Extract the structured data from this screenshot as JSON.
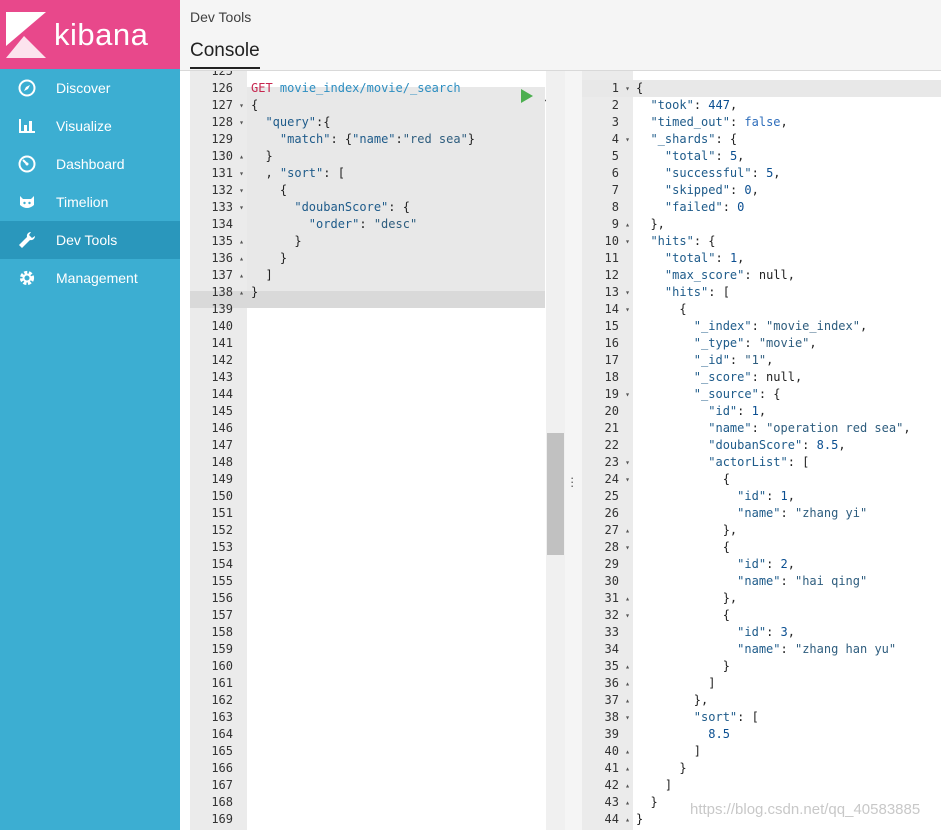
{
  "sidebar": {
    "logo_text": "kibana",
    "items": [
      {
        "label": "Discover",
        "icon": "compass-icon"
      },
      {
        "label": "Visualize",
        "icon": "bar-chart-icon"
      },
      {
        "label": "Dashboard",
        "icon": "dashboard-icon"
      },
      {
        "label": "Timelion",
        "icon": "timelion-icon"
      },
      {
        "label": "Dev Tools",
        "icon": "wrench-icon",
        "active": true
      },
      {
        "label": "Management",
        "icon": "gear-icon"
      }
    ]
  },
  "header": {
    "breadcrumb": "Dev Tools",
    "tab": "Console"
  },
  "editor": {
    "top_partial_line": "125",
    "lines": [
      {
        "n": "126",
        "fold": ""
      },
      {
        "n": "127",
        "fold": "▾"
      },
      {
        "n": "128",
        "fold": "▾"
      },
      {
        "n": "129",
        "fold": ""
      },
      {
        "n": "130",
        "fold": "▴"
      },
      {
        "n": "131",
        "fold": "▾"
      },
      {
        "n": "132",
        "fold": "▾"
      },
      {
        "n": "133",
        "fold": "▾"
      },
      {
        "n": "134",
        "fold": ""
      },
      {
        "n": "135",
        "fold": "▴"
      },
      {
        "n": "136",
        "fold": "▴"
      },
      {
        "n": "137",
        "fold": "▴"
      },
      {
        "n": "138",
        "fold": "▴"
      },
      {
        "n": "139",
        "fold": ""
      },
      {
        "n": "140",
        "fold": ""
      },
      {
        "n": "141",
        "fold": ""
      },
      {
        "n": "142",
        "fold": ""
      },
      {
        "n": "143",
        "fold": ""
      },
      {
        "n": "144",
        "fold": ""
      },
      {
        "n": "145",
        "fold": ""
      },
      {
        "n": "146",
        "fold": ""
      },
      {
        "n": "147",
        "fold": ""
      },
      {
        "n": "148",
        "fold": ""
      },
      {
        "n": "149",
        "fold": ""
      },
      {
        "n": "150",
        "fold": ""
      },
      {
        "n": "151",
        "fold": ""
      },
      {
        "n": "152",
        "fold": ""
      },
      {
        "n": "153",
        "fold": ""
      },
      {
        "n": "154",
        "fold": ""
      },
      {
        "n": "155",
        "fold": ""
      },
      {
        "n": "156",
        "fold": ""
      },
      {
        "n": "157",
        "fold": ""
      },
      {
        "n": "158",
        "fold": ""
      },
      {
        "n": "159",
        "fold": ""
      },
      {
        "n": "160",
        "fold": ""
      },
      {
        "n": "161",
        "fold": ""
      },
      {
        "n": "162",
        "fold": ""
      },
      {
        "n": "163",
        "fold": ""
      },
      {
        "n": "164",
        "fold": ""
      },
      {
        "n": "165",
        "fold": ""
      },
      {
        "n": "166",
        "fold": ""
      },
      {
        "n": "167",
        "fold": ""
      },
      {
        "n": "168",
        "fold": ""
      },
      {
        "n": "169",
        "fold": ""
      }
    ],
    "request": {
      "method": "GET",
      "url": "movie_index/movie/_search",
      "code": [
        "{",
        "  \"query\":{",
        "    \"match\": {\"name\":\"red sea\"}",
        "  }",
        "  , \"sort\": [",
        "    {",
        "      \"doubanScore\": {",
        "        \"order\": \"desc\"",
        "      }",
        "    }",
        "  ]",
        "}"
      ]
    }
  },
  "output": {
    "lines": [
      {
        "n": "1",
        "fold": "▾",
        "text": "{"
      },
      {
        "n": "2",
        "fold": "",
        "text": "  \"took\": 447,"
      },
      {
        "n": "3",
        "fold": "",
        "text": "  \"timed_out\": false,"
      },
      {
        "n": "4",
        "fold": "▾",
        "text": "  \"_shards\": {"
      },
      {
        "n": "5",
        "fold": "",
        "text": "    \"total\": 5,"
      },
      {
        "n": "6",
        "fold": "",
        "text": "    \"successful\": 5,"
      },
      {
        "n": "7",
        "fold": "",
        "text": "    \"skipped\": 0,"
      },
      {
        "n": "8",
        "fold": "",
        "text": "    \"failed\": 0"
      },
      {
        "n": "9",
        "fold": "▴",
        "text": "  },"
      },
      {
        "n": "10",
        "fold": "▾",
        "text": "  \"hits\": {"
      },
      {
        "n": "11",
        "fold": "",
        "text": "    \"total\": 1,"
      },
      {
        "n": "12",
        "fold": "",
        "text": "    \"max_score\": null,"
      },
      {
        "n": "13",
        "fold": "▾",
        "text": "    \"hits\": ["
      },
      {
        "n": "14",
        "fold": "▾",
        "text": "      {"
      },
      {
        "n": "15",
        "fold": "",
        "text": "        \"_index\": \"movie_index\","
      },
      {
        "n": "16",
        "fold": "",
        "text": "        \"_type\": \"movie\","
      },
      {
        "n": "17",
        "fold": "",
        "text": "        \"_id\": \"1\","
      },
      {
        "n": "18",
        "fold": "",
        "text": "        \"_score\": null,"
      },
      {
        "n": "19",
        "fold": "▾",
        "text": "        \"_source\": {"
      },
      {
        "n": "20",
        "fold": "",
        "text": "          \"id\": 1,"
      },
      {
        "n": "21",
        "fold": "",
        "text": "          \"name\": \"operation red sea\","
      },
      {
        "n": "22",
        "fold": "",
        "text": "          \"doubanScore\": 8.5,"
      },
      {
        "n": "23",
        "fold": "▾",
        "text": "          \"actorList\": ["
      },
      {
        "n": "24",
        "fold": "▾",
        "text": "            {"
      },
      {
        "n": "25",
        "fold": "",
        "text": "              \"id\": 1,"
      },
      {
        "n": "26",
        "fold": "",
        "text": "              \"name\": \"zhang yi\""
      },
      {
        "n": "27",
        "fold": "▴",
        "text": "            },"
      },
      {
        "n": "28",
        "fold": "▾",
        "text": "            {"
      },
      {
        "n": "29",
        "fold": "",
        "text": "              \"id\": 2,"
      },
      {
        "n": "30",
        "fold": "",
        "text": "              \"name\": \"hai qing\""
      },
      {
        "n": "31",
        "fold": "▴",
        "text": "            },"
      },
      {
        "n": "32",
        "fold": "▾",
        "text": "            {"
      },
      {
        "n": "33",
        "fold": "",
        "text": "              \"id\": 3,"
      },
      {
        "n": "34",
        "fold": "",
        "text": "              \"name\": \"zhang han yu\""
      },
      {
        "n": "35",
        "fold": "▴",
        "text": "            }"
      },
      {
        "n": "36",
        "fold": "▴",
        "text": "          ]"
      },
      {
        "n": "37",
        "fold": "▴",
        "text": "        },"
      },
      {
        "n": "38",
        "fold": "▾",
        "text": "        \"sort\": ["
      },
      {
        "n": "39",
        "fold": "",
        "text": "          8.5"
      },
      {
        "n": "40",
        "fold": "▴",
        "text": "        ]"
      },
      {
        "n": "41",
        "fold": "▴",
        "text": "      }"
      },
      {
        "n": "42",
        "fold": "▴",
        "text": "    ]"
      },
      {
        "n": "43",
        "fold": "▴",
        "text": "  }"
      },
      {
        "n": "44",
        "fold": "▴",
        "text": "}"
      }
    ]
  },
  "watermark": "https://blog.csdn.net/qq_40583885",
  "colors": {
    "sidebar": "#3caed2",
    "logo_bg": "#e8488b",
    "active_nav": "#2a97bc",
    "run_green": "#4caf50"
  }
}
